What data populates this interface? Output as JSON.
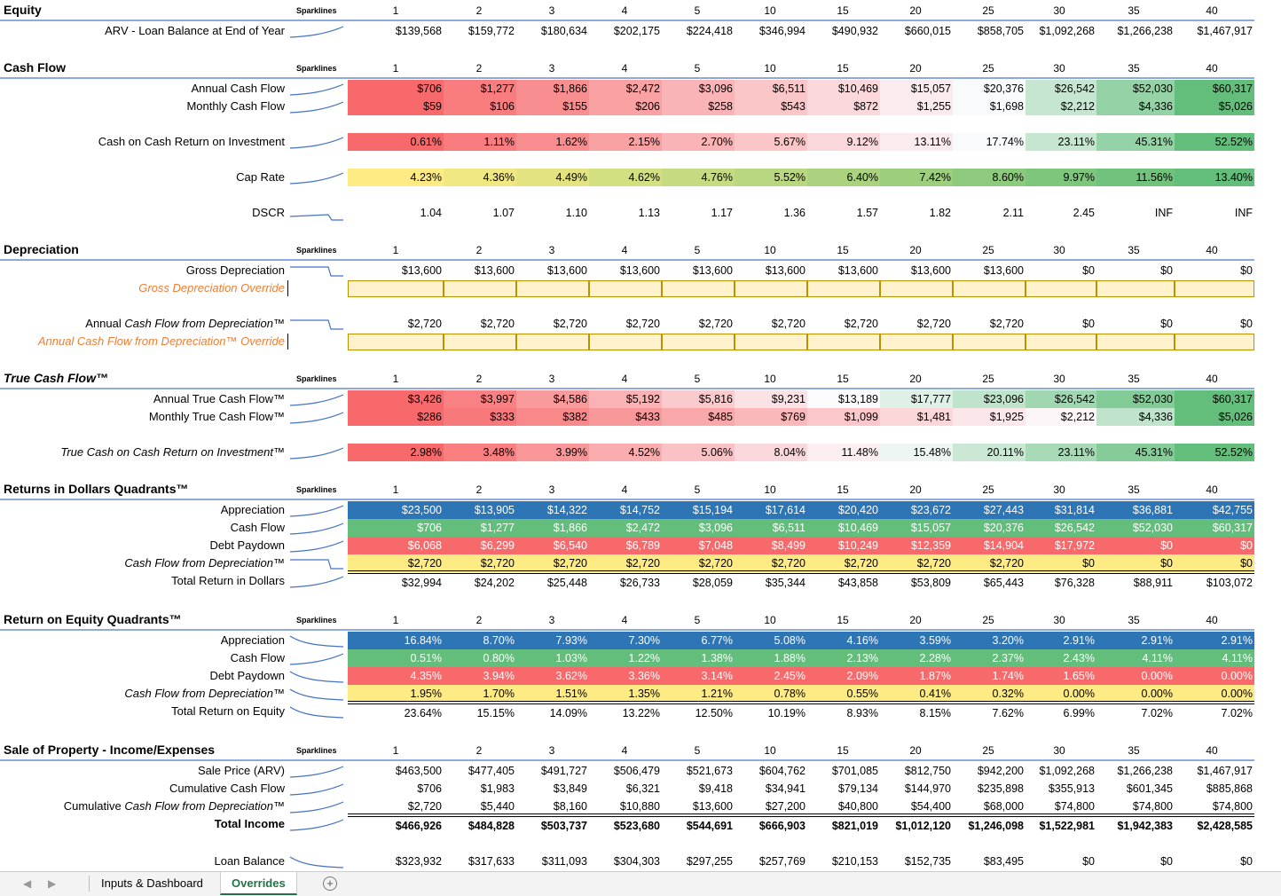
{
  "years": [
    "1",
    "2",
    "3",
    "4",
    "5",
    "10",
    "15",
    "20",
    "25",
    "30",
    "35",
    "40"
  ],
  "sparklines_label": "Sparklines",
  "colors": {
    "red": "#f8696b",
    "green": "#63be7b",
    "yellow": "#ffeb84",
    "blue": "#2e75b6",
    "override_fill": "#fff2cc",
    "header_line": "#8ea9db"
  },
  "sections": [
    {
      "title": "Equity",
      "italic": false,
      "rows": [
        {
          "label": "ARV - Loan Balance at End of Year",
          "spark": "up",
          "values": [
            "$139,568",
            "$159,772",
            "$180,634",
            "$202,175",
            "$224,418",
            "$346,994",
            "$490,932",
            "$660,015",
            "$858,705",
            "$1,092,268",
            "$1,266,238",
            "$1,467,917"
          ]
        }
      ]
    },
    {
      "title": "Cash Flow",
      "italic": false,
      "rows": [
        {
          "label": "Annual Cash Flow",
          "spark": "up",
          "fill": "scale",
          "values": [
            "$706",
            "$1,277",
            "$1,866",
            "$2,472",
            "$3,096",
            "$6,511",
            "$10,469",
            "$15,057",
            "$20,376",
            "$26,542",
            "$52,030",
            "$60,317"
          ]
        },
        {
          "label": "Monthly Cash Flow",
          "spark": "up",
          "fill": "scale",
          "values": [
            "$59",
            "$106",
            "$155",
            "$206",
            "$258",
            "$543",
            "$872",
            "$1,255",
            "$1,698",
            "$2,212",
            "$4,336",
            "$5,026"
          ]
        },
        {
          "label": "",
          "spark": "",
          "values": []
        },
        {
          "label": "Cash on Cash Return on Investment",
          "spark": "up",
          "fill": "scale",
          "values": [
            "0.61%",
            "1.11%",
            "1.62%",
            "2.15%",
            "2.70%",
            "5.67%",
            "9.12%",
            "13.11%",
            "17.74%",
            "23.11%",
            "45.31%",
            "52.52%"
          ]
        },
        {
          "label": "",
          "spark": "",
          "values": []
        },
        {
          "label": "Cap Rate",
          "spark": "up",
          "fill": "yg",
          "values": [
            "4.23%",
            "4.36%",
            "4.49%",
            "4.62%",
            "4.76%",
            "5.52%",
            "6.40%",
            "7.42%",
            "8.60%",
            "9.97%",
            "11.56%",
            "13.40%"
          ]
        },
        {
          "label": "",
          "spark": "",
          "values": []
        },
        {
          "label": "DSCR",
          "spark": "step",
          "values": [
            "1.04",
            "1.07",
            "1.10",
            "1.13",
            "1.17",
            "1.36",
            "1.57",
            "1.82",
            "2.11",
            "2.45",
            "INF",
            "INF"
          ]
        }
      ]
    },
    {
      "title": "Depreciation",
      "italic": false,
      "rows": [
        {
          "label": "Gross Depreciation",
          "spark": "drop",
          "values": [
            "$13,600",
            "$13,600",
            "$13,600",
            "$13,600",
            "$13,600",
            "$13,600",
            "$13,600",
            "$13,600",
            "$13,600",
            "$0",
            "$0",
            "$0"
          ]
        },
        {
          "label": "Gross Depreciation Override",
          "style": "orange",
          "spark": "",
          "override": true,
          "values": []
        },
        {
          "label": "",
          "spark": "",
          "values": []
        },
        {
          "label": "Annual Cash Flow from Depreciation™",
          "spark": "drop",
          "labelItalicPart": "Cash Flow from Depreciation™",
          "values": [
            "$2,720",
            "$2,720",
            "$2,720",
            "$2,720",
            "$2,720",
            "$2,720",
            "$2,720",
            "$2,720",
            "$2,720",
            "$0",
            "$0",
            "$0"
          ]
        },
        {
          "label": "Annual Cash Flow from Depreciation™ Override",
          "style": "orange",
          "spark": "",
          "override": true,
          "values": []
        }
      ]
    },
    {
      "title": "True Cash Flow™",
      "italic": true,
      "rows": [
        {
          "label": "Annual True Cash Flow™",
          "spark": "up",
          "fill": "scale2",
          "values": [
            "$3,426",
            "$3,997",
            "$4,586",
            "$5,192",
            "$5,816",
            "$9,231",
            "$13,189",
            "$17,777",
            "$23,096",
            "$26,542",
            "$52,030",
            "$60,317"
          ]
        },
        {
          "label": "Monthly True Cash Flow™",
          "spark": "up",
          "fill": "scale3",
          "values": [
            "$286",
            "$333",
            "$382",
            "$433",
            "$485",
            "$769",
            "$1,099",
            "$1,481",
            "$1,925",
            "$2,212",
            "$4,336",
            "$5,026"
          ]
        },
        {
          "label": "",
          "spark": "",
          "values": []
        },
        {
          "label": "True Cash on Cash Return on Investment™",
          "style": "it",
          "spark": "up",
          "fill": "scale4",
          "values": [
            "2.98%",
            "3.48%",
            "3.99%",
            "4.52%",
            "5.06%",
            "8.04%",
            "11.48%",
            "15.48%",
            "20.11%",
            "23.11%",
            "45.31%",
            "52.52%"
          ]
        }
      ]
    },
    {
      "title": "Returns in Dollars Quadrants™",
      "italic": false,
      "rows": [
        {
          "label": "Appreciation",
          "spark": "up",
          "fill": "blue",
          "values": [
            "$23,500",
            "$13,905",
            "$14,322",
            "$14,752",
            "$15,194",
            "$17,614",
            "$20,420",
            "$23,672",
            "$27,443",
            "$31,814",
            "$36,881",
            "$42,755"
          ]
        },
        {
          "label": "Cash Flow",
          "spark": "up",
          "fill": "green",
          "values": [
            "$706",
            "$1,277",
            "$1,866",
            "$2,472",
            "$3,096",
            "$6,511",
            "$10,469",
            "$15,057",
            "$20,376",
            "$26,542",
            "$52,030",
            "$60,317"
          ]
        },
        {
          "label": "Debt Paydown",
          "spark": "up",
          "fill": "red",
          "values": [
            "$6,068",
            "$6,299",
            "$6,540",
            "$6,789",
            "$7,048",
            "$8,499",
            "$10,249",
            "$12,359",
            "$14,904",
            "$17,972",
            "$0",
            "$0"
          ]
        },
        {
          "label": "Cash Flow from Depreciation™",
          "style": "it",
          "spark": "drop",
          "fill": "yellow",
          "values": [
            "$2,720",
            "$2,720",
            "$2,720",
            "$2,720",
            "$2,720",
            "$2,720",
            "$2,720",
            "$2,720",
            "$2,720",
            "$0",
            "$0",
            "$0"
          ]
        },
        {
          "label": "Total Return in Dollars",
          "spark": "up",
          "total": true,
          "values": [
            "$32,994",
            "$24,202",
            "$25,448",
            "$26,733",
            "$28,059",
            "$35,344",
            "$43,858",
            "$53,809",
            "$65,443",
            "$76,328",
            "$88,911",
            "$103,072"
          ]
        }
      ]
    },
    {
      "title": "Return on Equity Quadrants™",
      "italic": false,
      "rows": [
        {
          "label": "Appreciation",
          "spark": "down",
          "fill": "blue",
          "values": [
            "16.84%",
            "8.70%",
            "7.93%",
            "7.30%",
            "6.77%",
            "5.08%",
            "4.16%",
            "3.59%",
            "3.20%",
            "2.91%",
            "2.91%",
            "2.91%"
          ]
        },
        {
          "label": "Cash Flow",
          "spark": "up",
          "fill": "green",
          "values": [
            "0.51%",
            "0.80%",
            "1.03%",
            "1.22%",
            "1.38%",
            "1.88%",
            "2.13%",
            "2.28%",
            "2.37%",
            "2.43%",
            "4.11%",
            "4.11%"
          ]
        },
        {
          "label": "Debt Paydown",
          "spark": "down",
          "fill": "red",
          "values": [
            "4.35%",
            "3.94%",
            "3.62%",
            "3.36%",
            "3.14%",
            "2.45%",
            "2.09%",
            "1.87%",
            "1.74%",
            "1.65%",
            "0.00%",
            "0.00%"
          ]
        },
        {
          "label": "Cash Flow from Depreciation™",
          "style": "it",
          "spark": "down",
          "fill": "yellow",
          "values": [
            "1.95%",
            "1.70%",
            "1.51%",
            "1.35%",
            "1.21%",
            "0.78%",
            "0.55%",
            "0.41%",
            "0.32%",
            "0.00%",
            "0.00%",
            "0.00%"
          ]
        },
        {
          "label": "Total Return on Equity",
          "spark": "down",
          "total": true,
          "values": [
            "23.64%",
            "15.15%",
            "14.09%",
            "13.22%",
            "12.50%",
            "10.19%",
            "8.93%",
            "8.15%",
            "7.62%",
            "6.99%",
            "7.02%",
            "7.02%"
          ]
        }
      ]
    },
    {
      "title": "Sale of Property - Income/Expenses",
      "italic": false,
      "rows": [
        {
          "label": "Sale Price (ARV)",
          "spark": "up",
          "values": [
            "$463,500",
            "$477,405",
            "$491,727",
            "$506,479",
            "$521,673",
            "$604,762",
            "$701,085",
            "$812,750",
            "$942,200",
            "$1,092,268",
            "$1,266,238",
            "$1,467,917"
          ]
        },
        {
          "label": "Cumulative Cash Flow",
          "spark": "up",
          "values": [
            "$706",
            "$1,983",
            "$3,849",
            "$6,321",
            "$9,418",
            "$34,941",
            "$79,134",
            "$144,970",
            "$235,898",
            "$355,913",
            "$601,345",
            "$885,868"
          ]
        },
        {
          "label": "Cumulative Cash Flow from Depreciation™",
          "spark": "up",
          "labelItalicPart": "Cash Flow from Depreciation™",
          "values": [
            "$2,720",
            "$5,440",
            "$8,160",
            "$10,880",
            "$13,600",
            "$27,200",
            "$40,800",
            "$54,400",
            "$68,000",
            "$74,800",
            "$74,800",
            "$74,800"
          ]
        },
        {
          "label": "Total Income",
          "style": "b",
          "spark": "up",
          "total": true,
          "bold": true,
          "values": [
            "$466,926",
            "$484,828",
            "$503,737",
            "$523,680",
            "$544,691",
            "$666,903",
            "$821,019",
            "$1,012,120",
            "$1,246,098",
            "$1,522,981",
            "$1,942,383",
            "$2,428,585"
          ]
        },
        {
          "label": "",
          "spark": "",
          "values": []
        },
        {
          "label": "Loan Balance",
          "spark": "down",
          "values": [
            "$323,932",
            "$317,633",
            "$311,093",
            "$304,303",
            "$297,255",
            "$257,769",
            "$210,153",
            "$152,735",
            "$83,495",
            "$0",
            "$0",
            "$0"
          ]
        }
      ]
    }
  ],
  "tabs": [
    {
      "label": "Inputs & Dashboard",
      "active": false
    },
    {
      "label": "Overrides",
      "active": true
    }
  ]
}
